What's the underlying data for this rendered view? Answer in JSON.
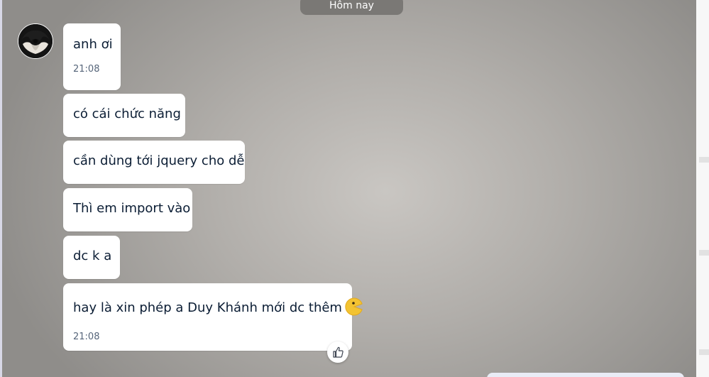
{
  "date_separator": "Hôm nay",
  "avatar": {
    "icon": "user-avatar"
  },
  "messages": [
    {
      "text": "anh ơi",
      "time": "21:08"
    },
    {
      "text": "có cái chức năng"
    },
    {
      "text": "cần dùng tới jquery cho dễ"
    },
    {
      "text": "Thì em import vào"
    },
    {
      "text": "dc k a"
    },
    {
      "text": "hay là xin phép a Duy Khánh mới dc thêm",
      "emoji": "pacman-face-emoji",
      "time": "21:08"
    }
  ],
  "reaction_button": {
    "icon": "thumbs-up-icon"
  },
  "colors": {
    "bubble_bg": "#ffffff",
    "text": "#0b1d34",
    "time": "#56657a",
    "badge_bg": "#7a7875",
    "emoji_yellow": "#f3c332"
  }
}
